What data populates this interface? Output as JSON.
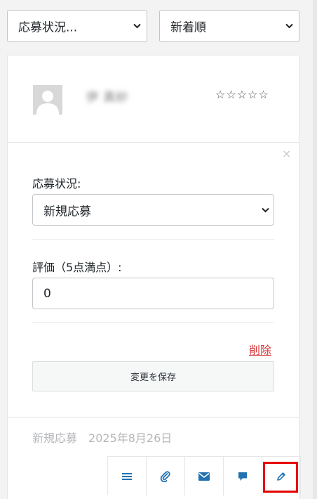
{
  "filters": {
    "status_value": "応募状況...",
    "sort_value": "新着順"
  },
  "applicant": {
    "name_blurred": "伊 真紗",
    "rating_stars": "☆☆☆☆☆",
    "rating_value": 0,
    "rating_max": 5
  },
  "edit_panel": {
    "close_symbol": "×",
    "status_label": "応募状況:",
    "status_value": "新規応募",
    "rating_label": "評価（5点満点）:",
    "rating_value": "0",
    "delete_label": "削除",
    "save_label": "変更を保存"
  },
  "meta": {
    "status": "新規応募",
    "date": "2025年8月26日"
  },
  "actions": [
    {
      "icon": "menu-icon"
    },
    {
      "icon": "paperclip-icon"
    },
    {
      "icon": "mail-icon"
    },
    {
      "icon": "comment-icon"
    },
    {
      "icon": "pencil-icon"
    }
  ],
  "colors": {
    "accent": "#2271b1",
    "delete": "#d63638",
    "highlight": "#e50000",
    "background": "#f3f3f4"
  }
}
